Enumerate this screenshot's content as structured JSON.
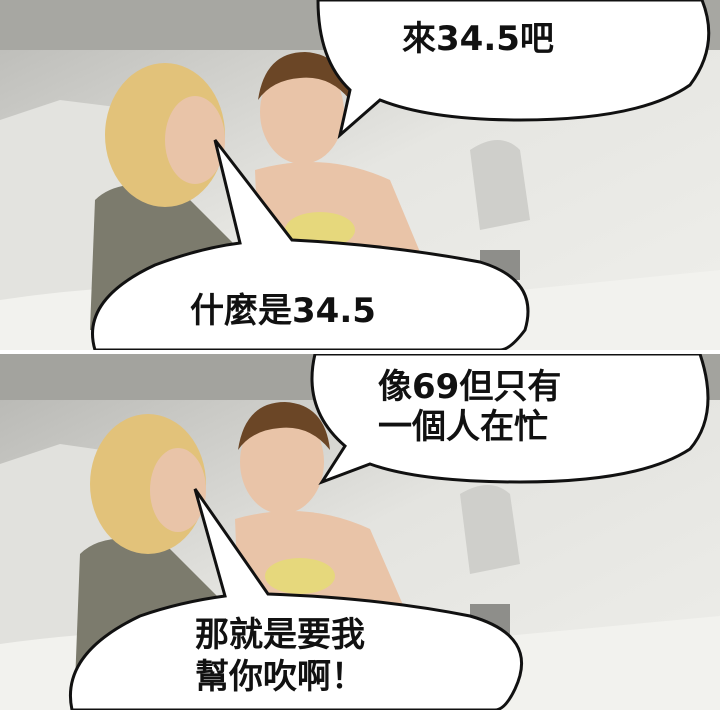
{
  "panels": [
    {
      "speaker": "man",
      "text": "來34.5吧"
    },
    {
      "speaker": "woman",
      "text": "什麼是34.5"
    },
    {
      "speaker": "man",
      "lines": [
        "像69但只有",
        "一個人在忙"
      ]
    },
    {
      "speaker": "woman",
      "lines": [
        "那就是要我",
        "幫你吹啊！"
      ]
    }
  ],
  "colors": {
    "bubble_fill": "#ffffff",
    "bubble_stroke": "#111111",
    "text": "#111111",
    "skin": "#e9c4a8",
    "hair_woman": "#e2c27a",
    "hair_man": "#6b4626"
  }
}
